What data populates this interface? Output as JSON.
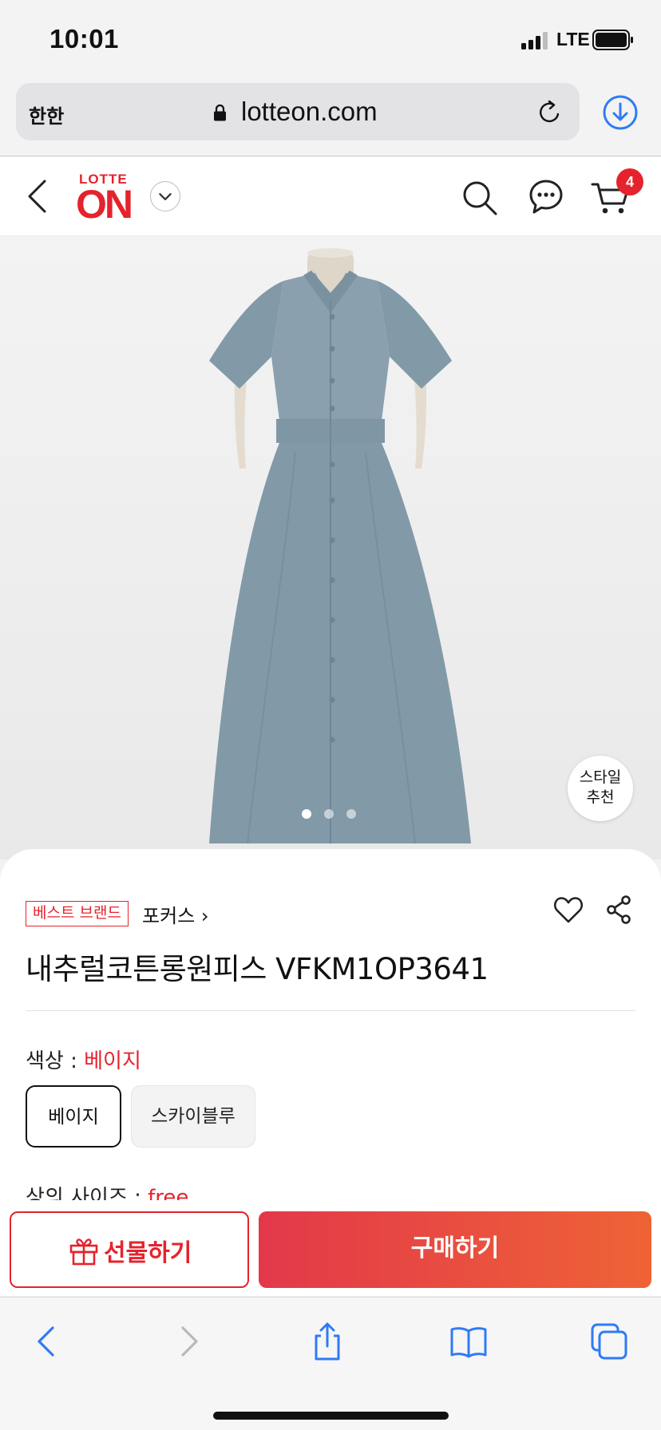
{
  "status_bar": {
    "time": "10:01",
    "network": "LTE"
  },
  "browser": {
    "text_size_label": "한한",
    "url": "lotteon.com"
  },
  "header": {
    "logo_top": "LOTTE",
    "logo_main": "ON",
    "cart_count": "4"
  },
  "gallery": {
    "style_recommend": "스타일\n추천",
    "image_count": 3,
    "active_index": 0
  },
  "product": {
    "badge": "베스트 브랜드",
    "brand": "포커스 ›",
    "title": "내추럴코튼롱원피스 VFKM1OP3641",
    "color_label": "색상 : ",
    "color_value": "베이지",
    "color_options": [
      "베이지",
      "스카이블루"
    ],
    "size_label": "상의 사이즈 : ",
    "size_value": "free"
  },
  "actions": {
    "gift": "선물하기",
    "buy": "구매하기"
  },
  "colors": {
    "brand_red": "#e5232d",
    "ios_blue": "#2f7bf5",
    "dress_blue": "#8299a8"
  }
}
